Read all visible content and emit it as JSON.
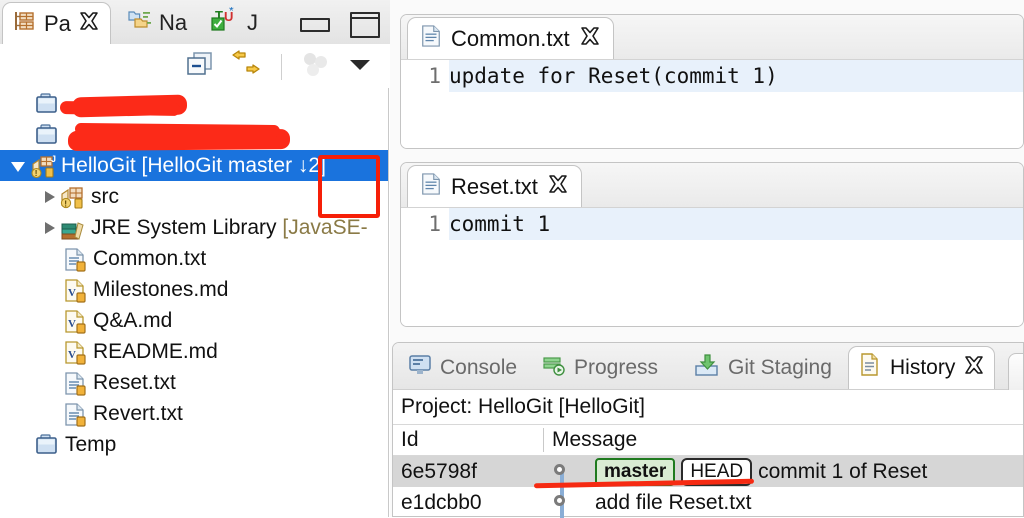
{
  "left_view": {
    "tabs": [
      {
        "label": "Pa",
        "icon": "package-explorer-icon",
        "active": true,
        "closable": true
      },
      {
        "label": "Na",
        "icon": "navigator-icon",
        "active": false,
        "closable": false
      },
      {
        "label": "J",
        "icon": "junit-icon",
        "active": false,
        "closable": false
      }
    ],
    "window_buttons": [
      {
        "name": "minimize-button",
        "label": ""
      },
      {
        "name": "maximize-button",
        "label": ""
      }
    ],
    "toolbar": [
      {
        "name": "collapse-all-icon",
        "label": ""
      },
      {
        "name": "link-with-editor-icon",
        "label": ""
      },
      {
        "name": "filter-icon",
        "label": ""
      },
      {
        "name": "view-menu-icon",
        "label": ""
      }
    ],
    "tree": [
      {
        "label": "",
        "indent": 0,
        "icon": "project-closed-icon",
        "arrow": "none",
        "redacted": true
      },
      {
        "label": "",
        "indent": 0,
        "icon": "project-closed-icon",
        "arrow": "none",
        "redacted": true
      },
      {
        "label": "HelloGit [HelloGit master ↓2]",
        "indent": 0,
        "icon": "java-project-icon",
        "arrow": "open",
        "selected": true
      },
      {
        "label": "src",
        "indent": 1,
        "icon": "source-folder-icon",
        "arrow": "closed"
      },
      {
        "label": "JRE System Library ",
        "dim": "[JavaSE-",
        "indent": 1,
        "icon": "library-icon",
        "arrow": "closed"
      },
      {
        "label": "Common.txt",
        "indent": 2,
        "icon": "text-file-icon",
        "arrow": "none"
      },
      {
        "label": "Milestones.md",
        "indent": 2,
        "icon": "markdown-file-icon",
        "arrow": "none"
      },
      {
        "label": "Q&A.md",
        "indent": 2,
        "icon": "markdown-file-icon",
        "arrow": "none"
      },
      {
        "label": "README.md",
        "indent": 2,
        "icon": "markdown-file-icon",
        "arrow": "none"
      },
      {
        "label": "Reset.txt",
        "indent": 2,
        "icon": "text-file-icon",
        "arrow": "none"
      },
      {
        "label": "Revert.txt",
        "indent": 2,
        "icon": "text-file-icon",
        "arrow": "none"
      },
      {
        "label": "Temp",
        "indent": 0,
        "icon": "project-closed-icon",
        "arrow": "none"
      }
    ]
  },
  "editors": [
    {
      "tab_label": "Common.txt",
      "icon": "text-file-icon",
      "close_label": "✖",
      "lines": [
        {
          "number": "1",
          "text": "update for Reset(commit 1)"
        }
      ]
    },
    {
      "tab_label": "Reset.txt",
      "icon": "text-file-icon",
      "close_label": "✖",
      "lines": [
        {
          "number": "1",
          "text": "commit 1"
        }
      ]
    }
  ],
  "bottom_view": {
    "tabs": [
      {
        "label": "Console",
        "icon": "console-icon",
        "active": false
      },
      {
        "label": "Progress",
        "icon": "progress-icon",
        "active": false
      },
      {
        "label": "Git Staging",
        "icon": "git-staging-icon",
        "active": false
      },
      {
        "label": "History",
        "icon": "history-icon",
        "active": true
      }
    ],
    "project_line": "Project: HelloGit [HelloGit]",
    "columns": [
      "Id",
      "Message"
    ],
    "commits": [
      {
        "id": "6e5798f",
        "badges": [
          {
            "text": "master",
            "type": "branch"
          },
          {
            "text": "HEAD",
            "type": "head"
          }
        ],
        "message": "commit 1 of Reset",
        "selected": true
      },
      {
        "id": "e1dcbb0",
        "badges": [],
        "message": "add file Reset.txt",
        "selected": false
      }
    ]
  },
  "colors": {
    "selection_blue": "#1a73dd",
    "annotation_red": "#f61f08",
    "branch_badge_bg": "#d9ecd3",
    "branch_badge_border": "#1f7a1f",
    "row_selected_gray": "#d6d6d6",
    "code_line_highlight": "#e8f1fb"
  }
}
